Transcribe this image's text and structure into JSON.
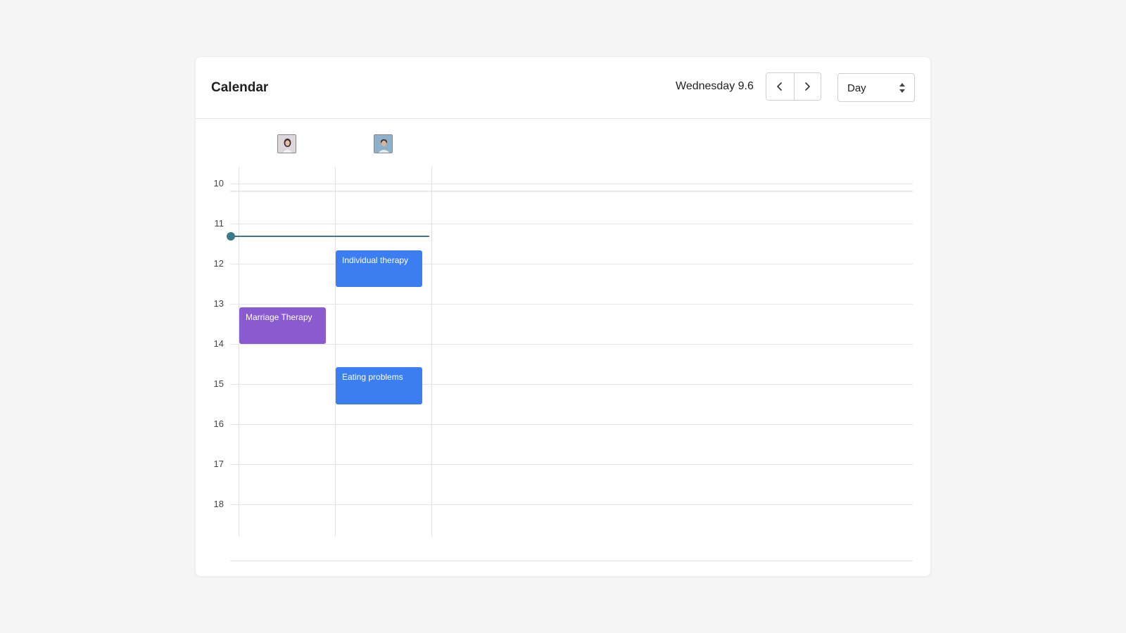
{
  "header": {
    "title": "Calendar",
    "date_label": "Wednesday 9.6",
    "view": {
      "selected": "Day"
    }
  },
  "icons": {
    "prev": "chevron-left-icon",
    "next": "chevron-right-icon",
    "select": "sort-arrows-icon"
  },
  "resources": [
    {
      "avatar": "woman-portrait",
      "color": "#9a8ea0"
    },
    {
      "avatar": "man-portrait",
      "color": "#6b8aa5"
    }
  ],
  "hours": [
    "10",
    "11",
    "12",
    "13",
    "14",
    "15",
    "16",
    "17",
    "18"
  ],
  "current_time": "11:20",
  "events": [
    {
      "title": "Individual therapy",
      "resource": 1,
      "start": "11:40",
      "end": "12:35",
      "color": "#3b7ef2"
    },
    {
      "title": "Marriage Therapy",
      "resource": 0,
      "start": "13:05",
      "end": "14:00",
      "color": "#8a5ad0"
    },
    {
      "title": "Eating problems",
      "resource": 1,
      "start": "14:35",
      "end": "15:30",
      "color": "#3b7ef2"
    }
  ]
}
